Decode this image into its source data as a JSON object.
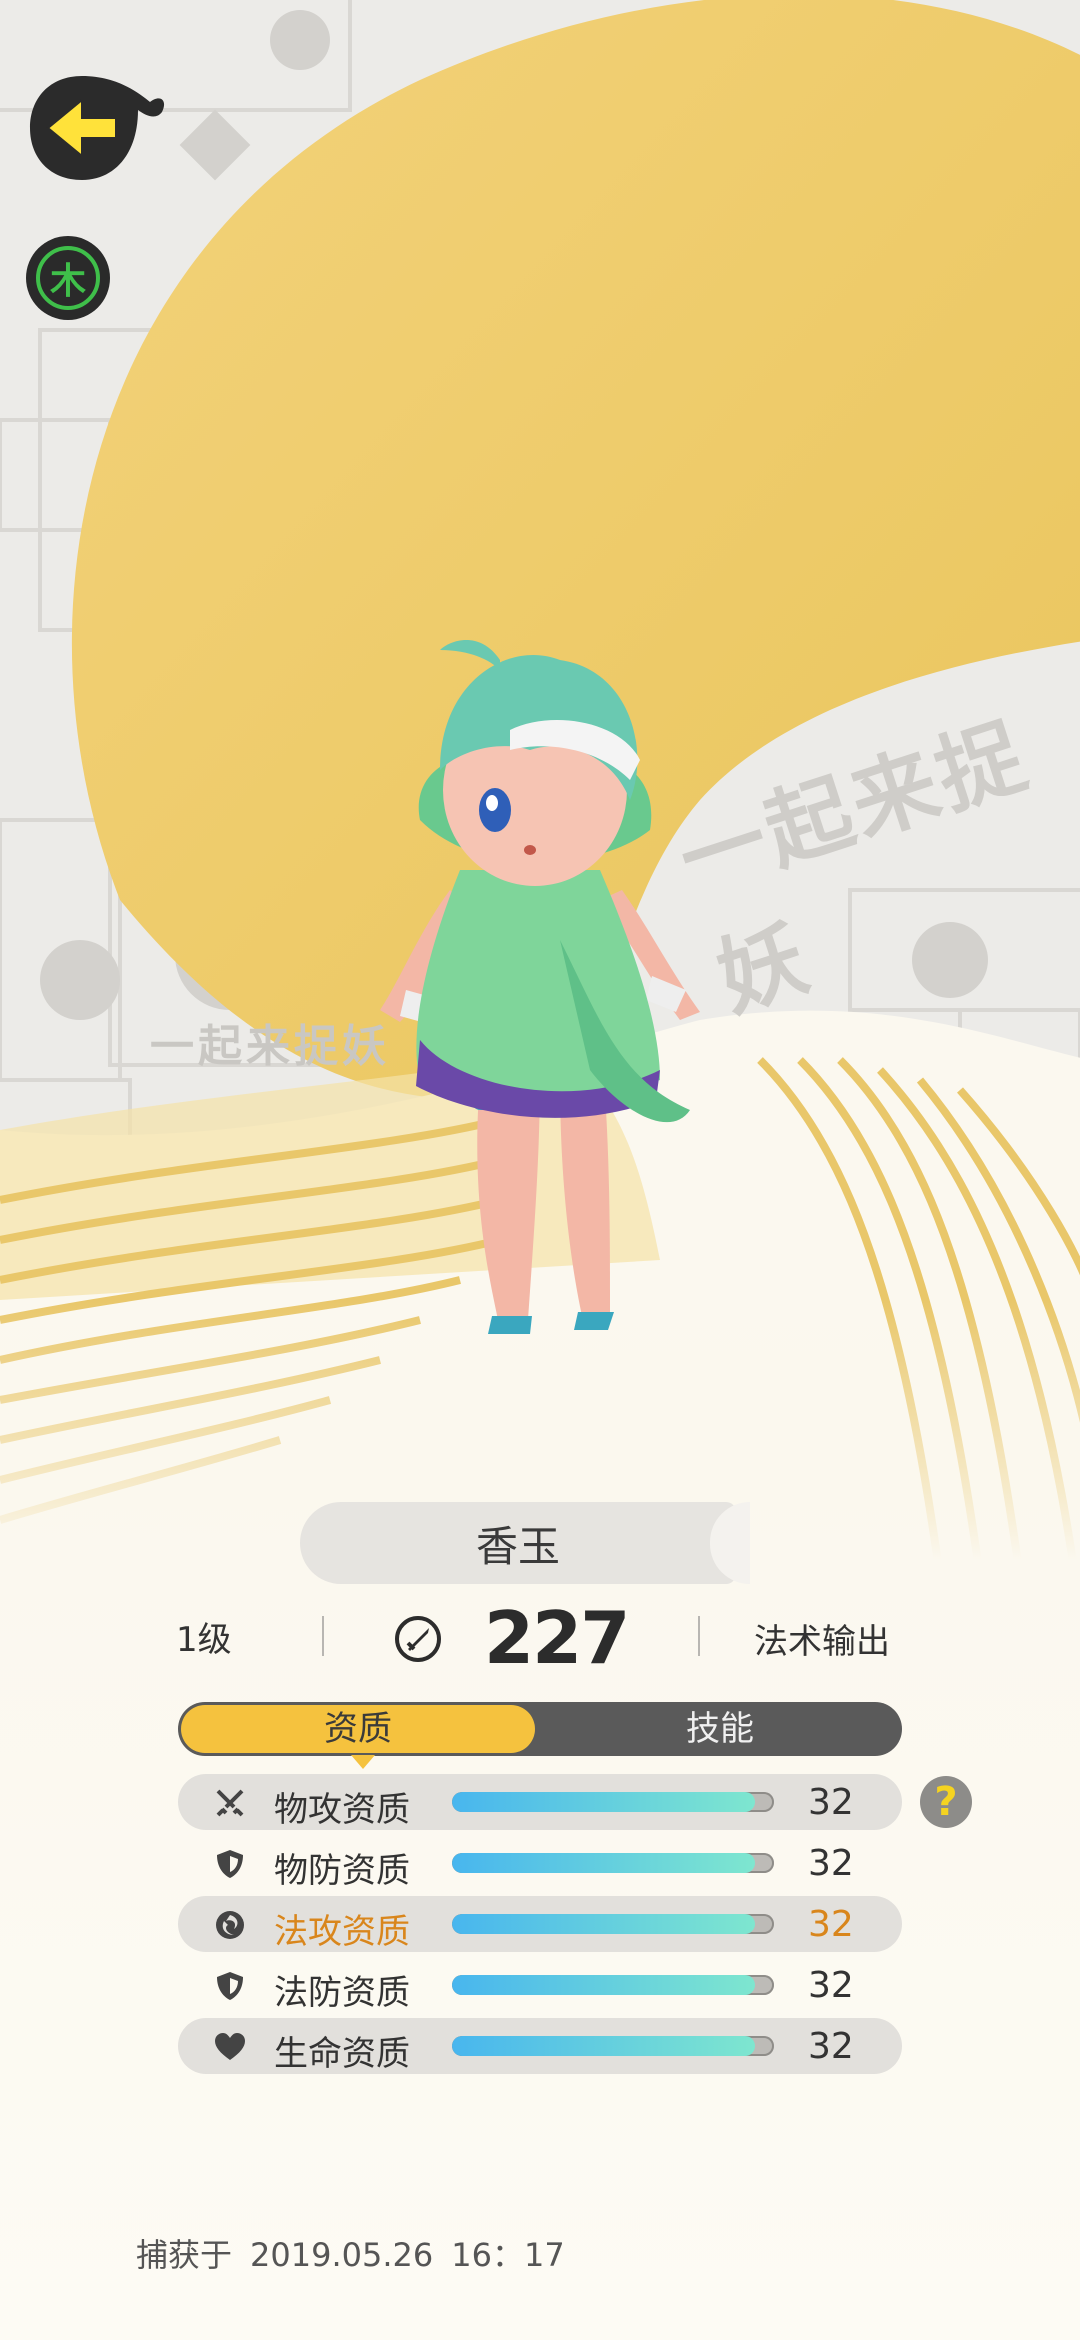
{
  "element_badge": {
    "glyph": "木",
    "color": "#3fbf4a"
  },
  "background": {
    "watermark_text": "一起来捉妖",
    "gold": "#f1cd6c"
  },
  "pet": {
    "name": "香玉",
    "level": "1级",
    "power": "227",
    "role": "法术输出"
  },
  "tabs": {
    "aptitude": "资质",
    "skills": "技能"
  },
  "aptitudes": [
    {
      "icon": "swords-icon",
      "label": "物攻资质",
      "value": "32",
      "fill": 0.94,
      "highlight": false
    },
    {
      "icon": "shield-icon",
      "label": "物防资质",
      "value": "32",
      "fill": 0.94,
      "highlight": false
    },
    {
      "icon": "magic-orb-icon",
      "label": "法攻资质",
      "value": "32",
      "fill": 0.94,
      "highlight": true
    },
    {
      "icon": "shield-icon",
      "label": "法防资质",
      "value": "32",
      "fill": 0.94,
      "highlight": false
    },
    {
      "icon": "heart-icon",
      "label": "生命资质",
      "value": "32",
      "fill": 0.94,
      "highlight": false
    }
  ],
  "help": {
    "glyph": "?"
  },
  "capture": {
    "label": "捕获于",
    "date": "2019.05.26",
    "time": "16：17"
  }
}
